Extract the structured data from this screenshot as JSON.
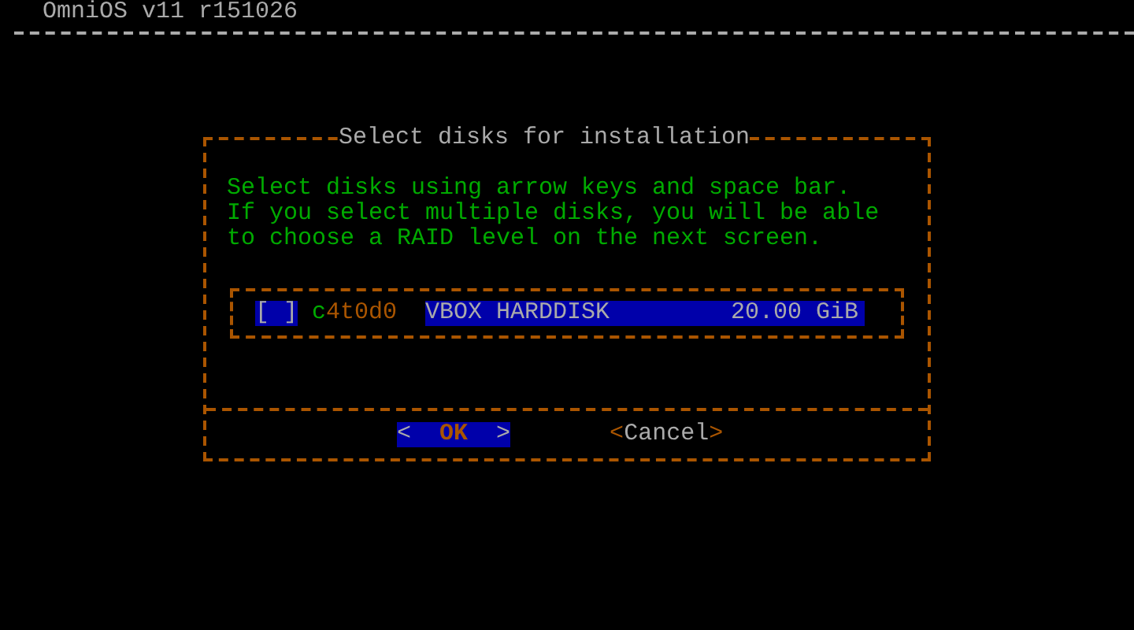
{
  "header": {
    "title": "OmniOS v11 r151026"
  },
  "dialog": {
    "title": "Select disks for installation",
    "message": [
      "Select disks using arrow keys and space bar.",
      "If you select multiple disks, you will be able",
      "to choose a RAID level on the next screen."
    ],
    "disks": [
      {
        "checkbox": "[ ]",
        "device": "c4t0d0",
        "model": "VBOX HARDDISK",
        "size": "20.00 GiB",
        "selected": true
      }
    ],
    "buttons": [
      {
        "open": "<",
        "label": "OK",
        "close": ">",
        "selected": true
      },
      {
        "open": "<",
        "label": "Cancel",
        "close": ">",
        "selected": false
      }
    ]
  }
}
